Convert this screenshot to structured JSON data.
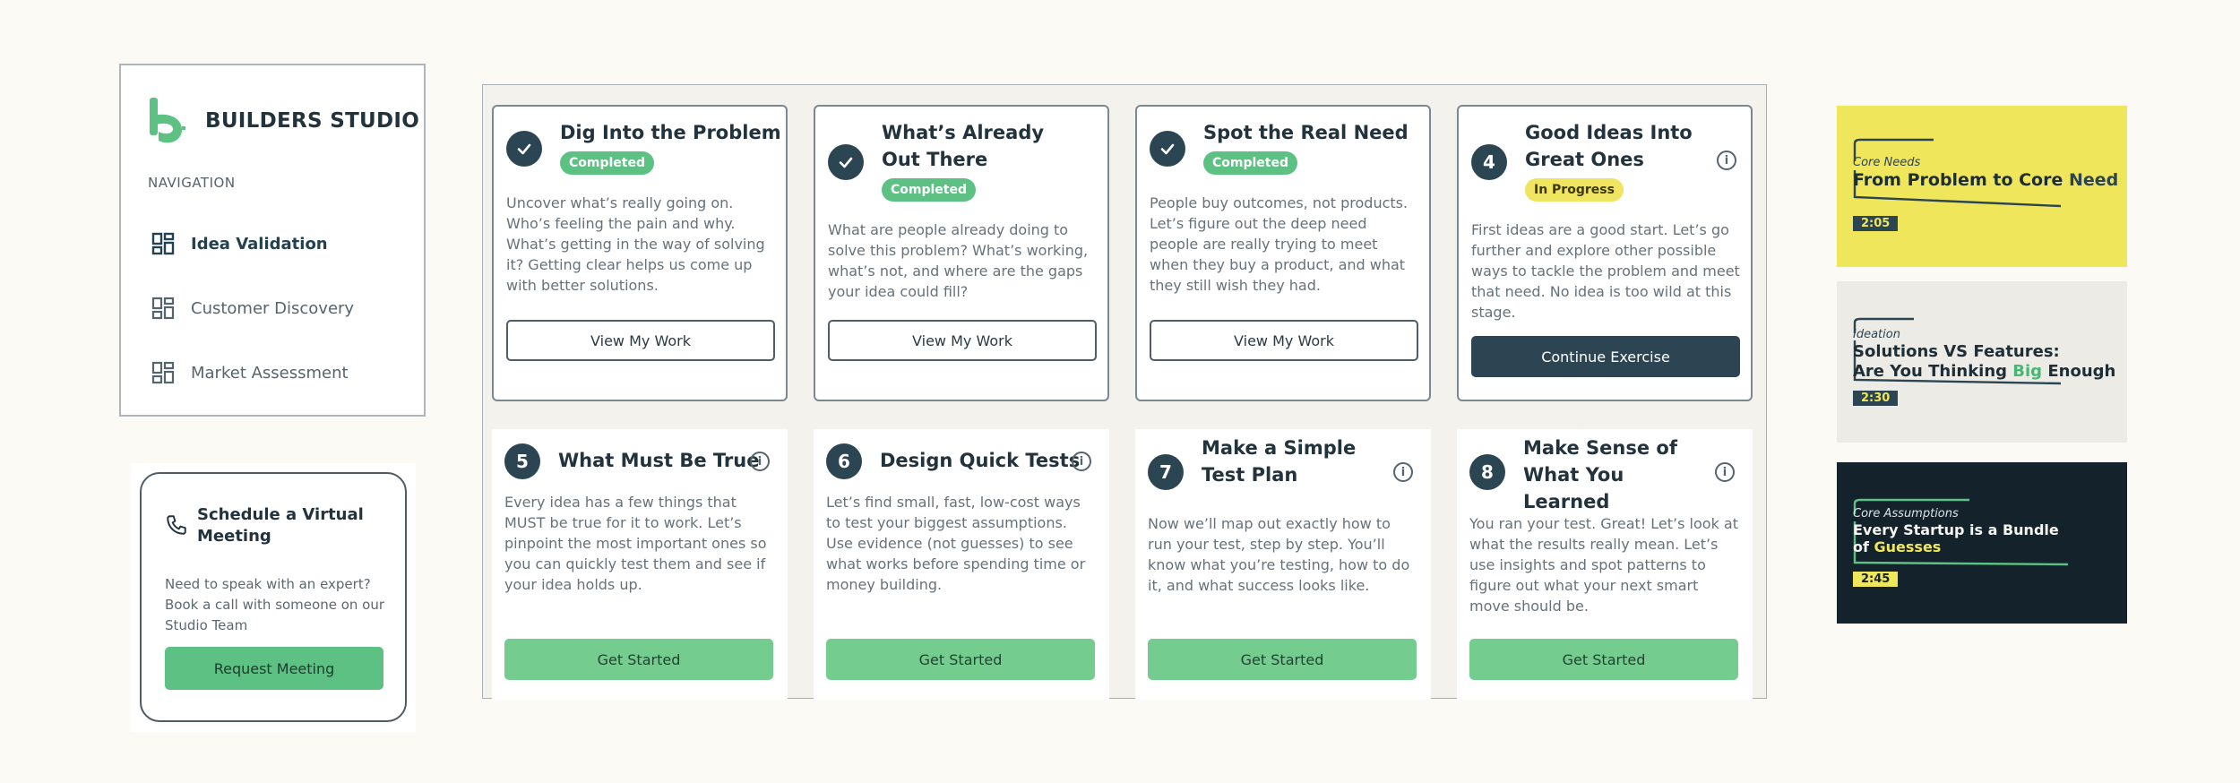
{
  "nav": {
    "brand": "BUILDERS STUDIO",
    "heading": "NAVIGATION",
    "items": [
      {
        "label": "Idea Validation",
        "active": true
      },
      {
        "label": "Customer Discovery",
        "active": false
      },
      {
        "label": "Market Assessment",
        "active": false
      }
    ]
  },
  "meeting": {
    "title": "Schedule a Virtual Meeting",
    "description": "Need to speak with an expert? Book a call with someone on our Studio Team",
    "button": "Request Meeting"
  },
  "exercises": [
    {
      "title": "Dig Into the Problem",
      "status": "Completed",
      "description": "Uncover what’s really going on. Who’s feeling the pain and why. What’s getting in the way of solving it? Getting clear helps us come up with better solutions.",
      "button": "View My Work"
    },
    {
      "title": "What’s Already Out There",
      "status": "Completed",
      "description": "What are people already doing to solve this problem? What’s working, what’s not, and where are the gaps your idea could fill?",
      "button": "View My Work"
    },
    {
      "title": "Spot the Real Need",
      "status": "Completed",
      "description": "People buy outcomes, not products. Let’s figure out the deep need people are really trying to meet when they buy a product, and what they still wish they had.",
      "button": "View My Work"
    },
    {
      "number": "4",
      "title": "Good Ideas Into Great Ones",
      "status": "In Progress",
      "description": "First ideas are a good start. Let’s go further and explore other possible ways to tackle the problem and meet that need. No idea is too wild at this stage.",
      "button": "Continue Exercise"
    },
    {
      "number": "5",
      "title": "What Must Be True",
      "description": "Every idea has a few things that MUST be true for it to work. Let’s pinpoint the most important ones so you can quickly test them and see if your idea holds up.",
      "button": "Get Started"
    },
    {
      "number": "6",
      "title": "Design Quick Tests",
      "description": "Let’s find small, fast, low-cost ways to test your biggest assumptions. Use evidence (not guesses) to see what works before spending time or money building.",
      "button": "Get Started"
    },
    {
      "number": "7",
      "title": "Make a Simple Test Plan",
      "description": "Now we’ll map out exactly how to run your test, step by step. You’ll know what you’re testing, how to do it, and what success looks like.",
      "button": "Get Started"
    },
    {
      "number": "8",
      "title": "Make Sense of What You Learned",
      "description": "You ran your test. Great! Let’s look at what the results really mean. Let’s use insights and spot patterns to figure out what your next smart move should be.",
      "button": "Get Started"
    }
  ],
  "videos": [
    {
      "category": "Core Needs",
      "title_a": "From Problem to Core ",
      "title_b": "Need",
      "title_c": "",
      "duration": "2:05",
      "bg": "#f0e65c",
      "accent": "#2c4552"
    },
    {
      "category": "Ideation",
      "title_a": "Solutions VS Features:",
      "title_b": "Are You Thinking ",
      "title_c": "Big",
      "title_d": " Enough",
      "duration": "2:30",
      "bg": "#ecebe6",
      "accent": "#2c4552"
    },
    {
      "category": "Core Assumptions",
      "title_a": "Every Startup is a Bundle",
      "title_b": "of ",
      "title_c": "Guesses",
      "duration": "2:45",
      "bg": "#14232b",
      "accent": "#5ec184"
    }
  ]
}
